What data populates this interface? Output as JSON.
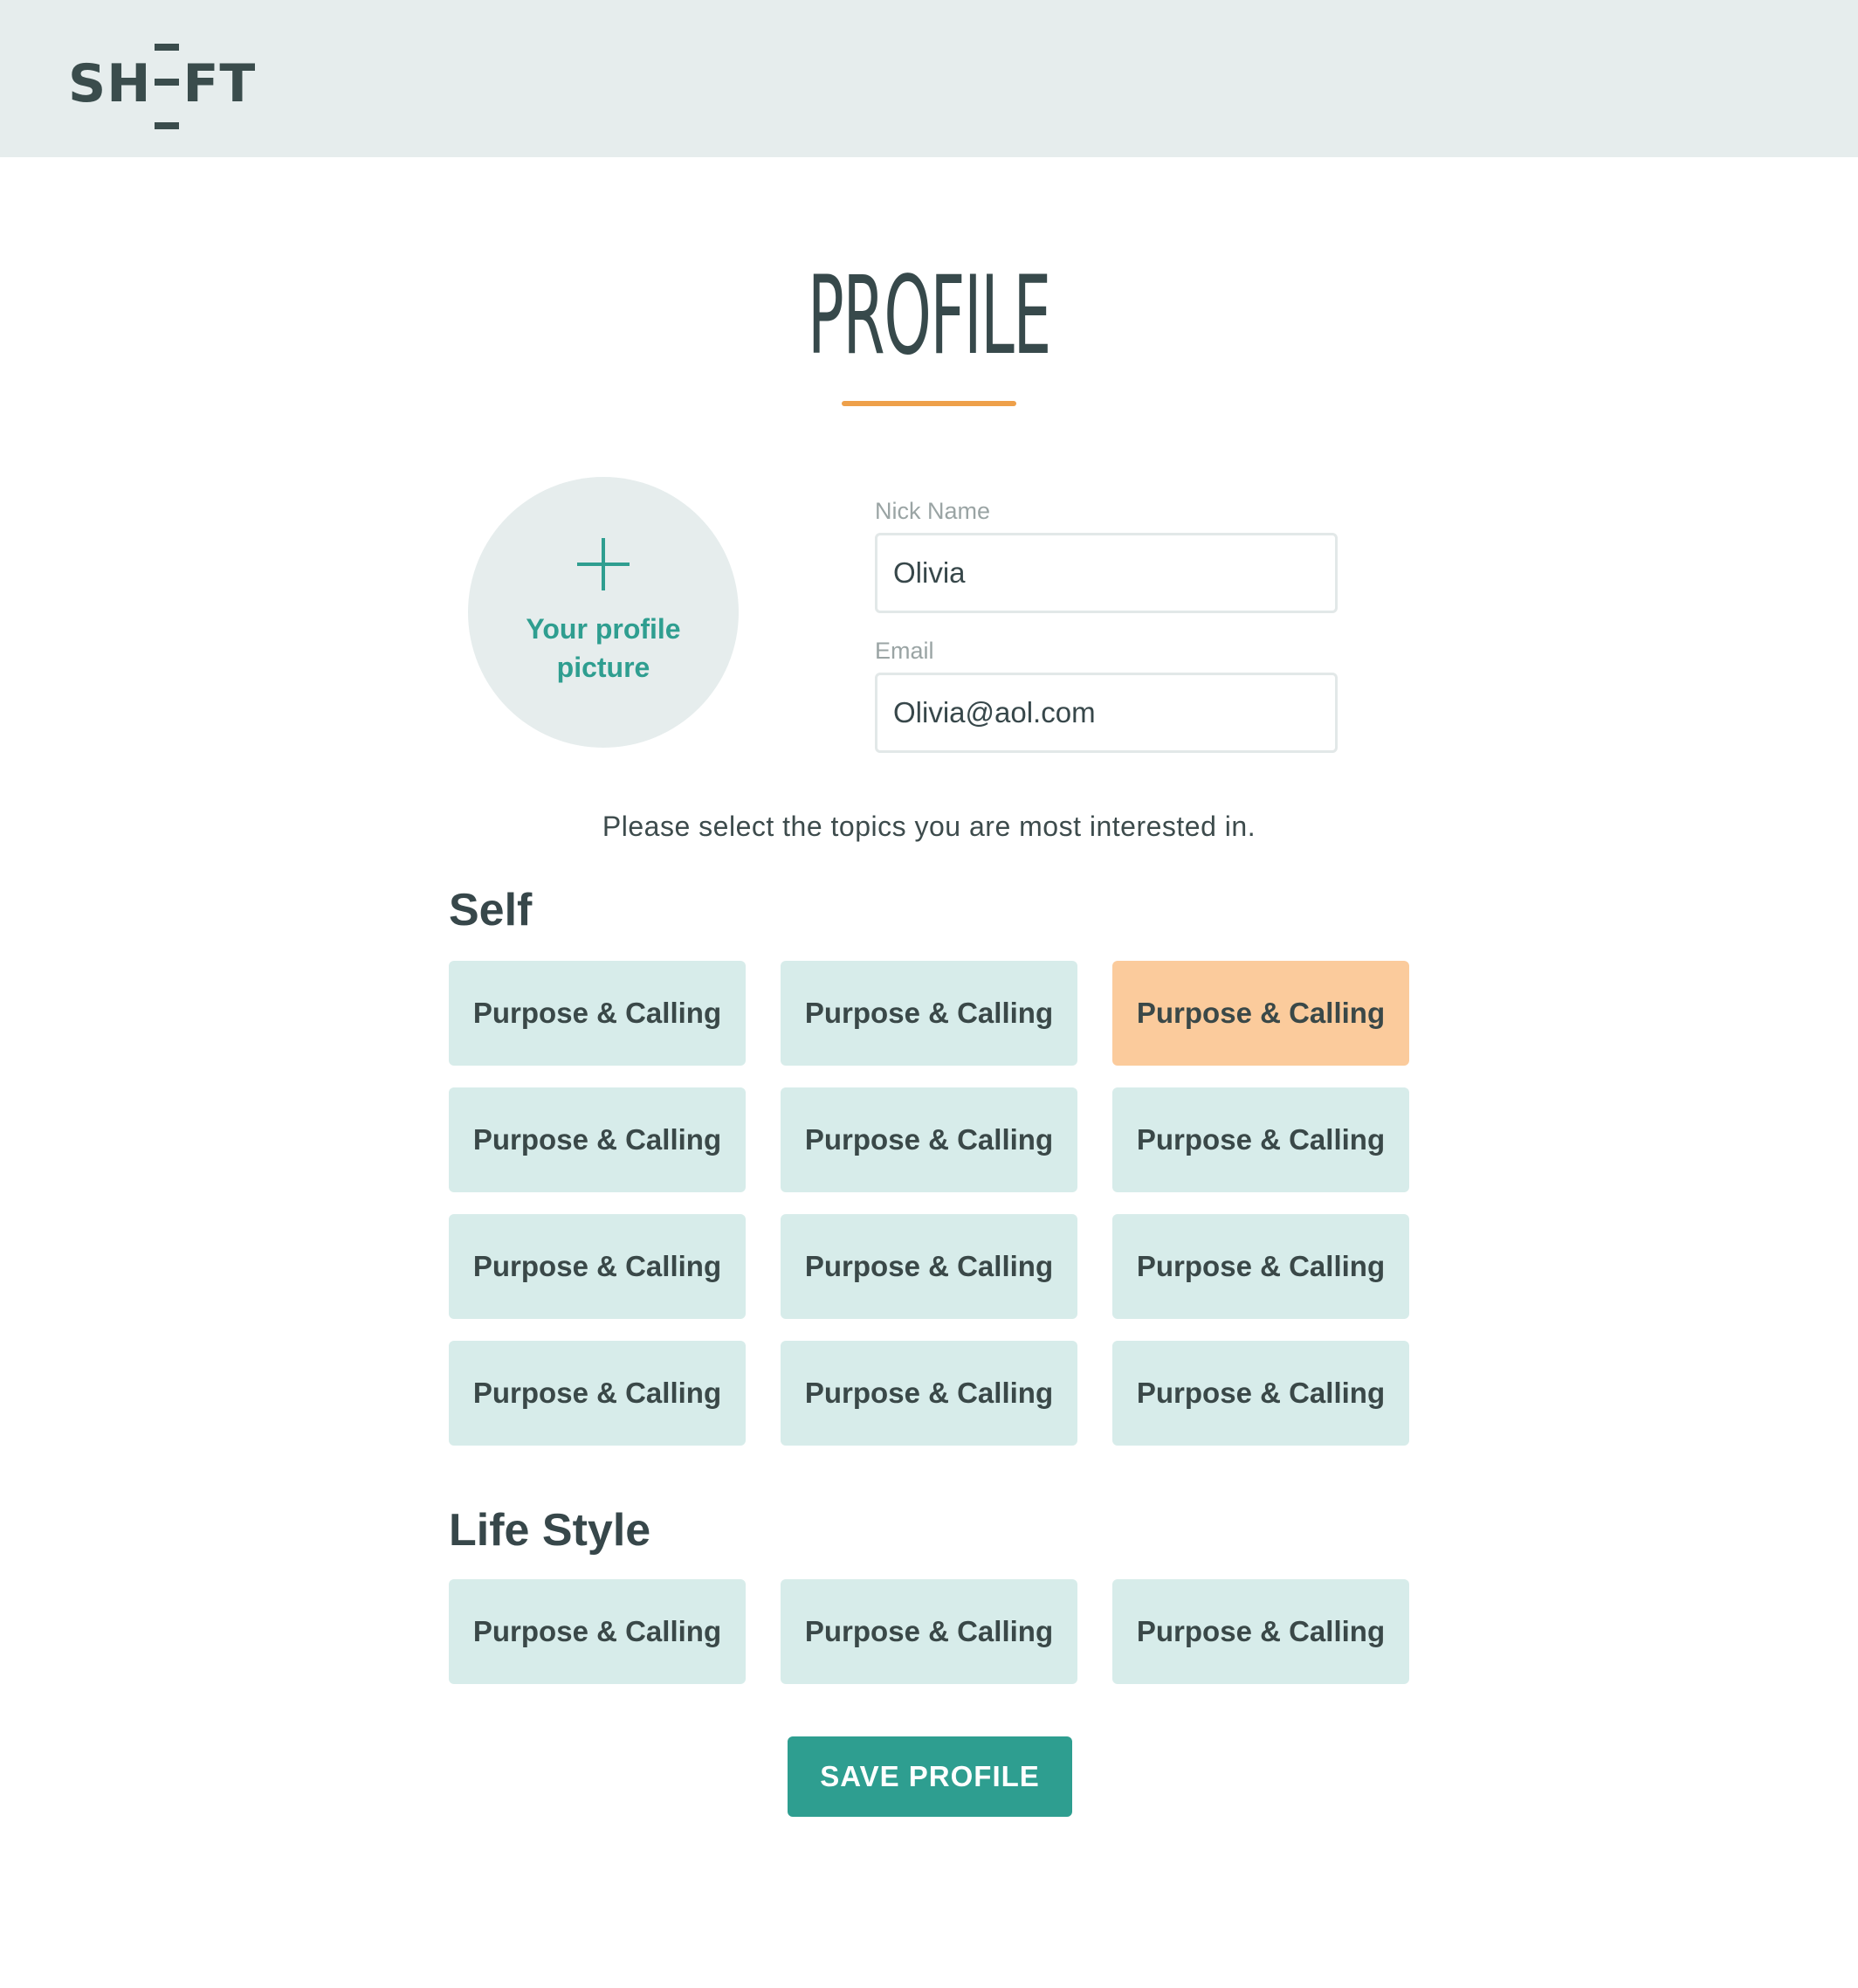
{
  "header": {
    "logo_text_left": "SH",
    "logo_text_right": "FT",
    "logo_icon": "shift-logo-icon"
  },
  "page": {
    "title": "PROFILE",
    "accent_color": "#eea04a",
    "brand_color": "#2e9e90"
  },
  "profile_picture": {
    "label": "Your profile picture",
    "icon": "plus-icon"
  },
  "form": {
    "nickname": {
      "label": "Nick Name",
      "value": "Olivia"
    },
    "email": {
      "label": "Email",
      "value": "Olivia@aol.com"
    }
  },
  "prompt": "Please select the topics you are most interested in.",
  "sections": {
    "self": {
      "heading": "Self",
      "topics": [
        {
          "label": "Purpose & Calling",
          "selected": false
        },
        {
          "label": "Purpose & Calling",
          "selected": false
        },
        {
          "label": "Purpose & Calling",
          "selected": true
        },
        {
          "label": "Purpose & Calling",
          "selected": false
        },
        {
          "label": "Purpose & Calling",
          "selected": false
        },
        {
          "label": "Purpose & Calling",
          "selected": false
        },
        {
          "label": "Purpose & Calling",
          "selected": false
        },
        {
          "label": "Purpose & Calling",
          "selected": false
        },
        {
          "label": "Purpose & Calling",
          "selected": false
        },
        {
          "label": "Purpose & Calling",
          "selected": false
        },
        {
          "label": "Purpose & Calling",
          "selected": false
        },
        {
          "label": "Purpose & Calling",
          "selected": false
        }
      ]
    },
    "lifestyle": {
      "heading": "Life Style",
      "topics": [
        {
          "label": "Purpose & Calling",
          "selected": false
        },
        {
          "label": "Purpose & Calling",
          "selected": false
        },
        {
          "label": "Purpose & Calling",
          "selected": false
        }
      ]
    }
  },
  "actions": {
    "save_label": "SAVE PROFILE"
  },
  "colors": {
    "topic_default": "#d7ecea",
    "topic_selected": "#fbcb9c",
    "header_bg": "#e6eded"
  }
}
